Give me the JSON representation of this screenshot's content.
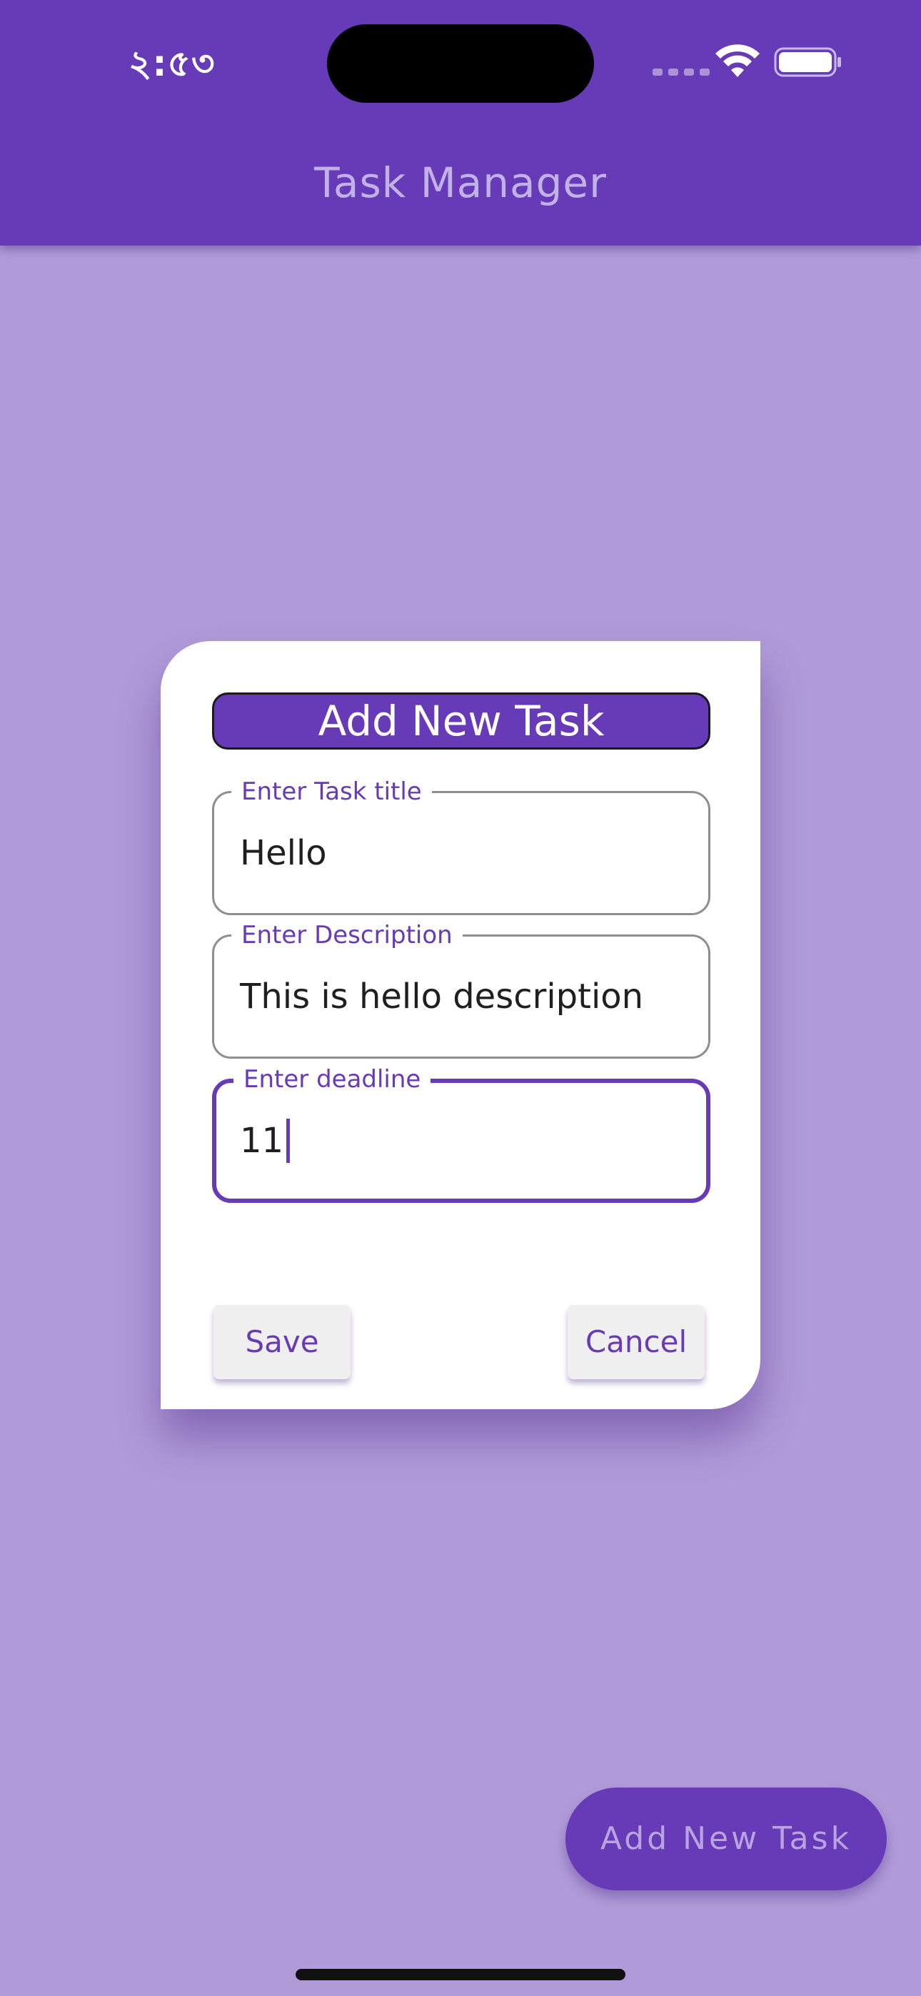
{
  "status_bar": {
    "time": "২:৫৩"
  },
  "app_bar": {
    "title": "Task Manager"
  },
  "dialog": {
    "title": "Add New Task",
    "fields": [
      {
        "label": "Enter Task title",
        "value": "Hello"
      },
      {
        "label": "Enter Description",
        "value": "This is hello description"
      },
      {
        "label": "Enter deadline",
        "value": "11"
      }
    ],
    "save_label": "Save",
    "cancel_label": "Cancel"
  },
  "fab": {
    "label": "Add New Task"
  },
  "colors": {
    "primary": "#673ab7",
    "background": "#b09bd8",
    "surface": "#ffffff"
  }
}
